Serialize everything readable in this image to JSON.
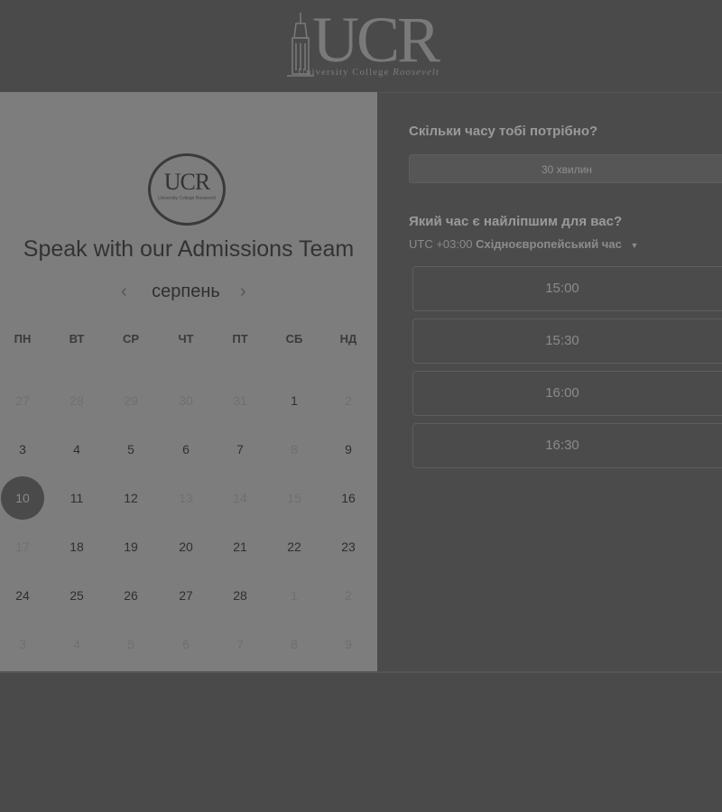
{
  "header": {
    "logo_text": "UCR",
    "logo_sub_main": "University College",
    "logo_sub_italic": "Roosevelt"
  },
  "calendar": {
    "badge_text": "UCR",
    "badge_sub": "University College Roosevelt",
    "title": "Speak with our Admissions Team",
    "month": "серпень",
    "prev_icon": "‹",
    "next_icon": "›",
    "weekdays": [
      "ПН",
      "ВТ",
      "СР",
      "ЧТ",
      "ПТ",
      "СБ",
      "НД"
    ],
    "weeks": [
      [
        {
          "d": "27",
          "muted": true
        },
        {
          "d": "28",
          "muted": true
        },
        {
          "d": "29",
          "muted": true
        },
        {
          "d": "30",
          "muted": true
        },
        {
          "d": "31",
          "muted": true
        },
        {
          "d": "1"
        },
        {
          "d": "2",
          "muted": true
        }
      ],
      [
        {
          "d": "3"
        },
        {
          "d": "4"
        },
        {
          "d": "5"
        },
        {
          "d": "6"
        },
        {
          "d": "7"
        },
        {
          "d": "8",
          "muted": true
        },
        {
          "d": "9"
        }
      ],
      [
        {
          "d": "10",
          "selected": true
        },
        {
          "d": "11"
        },
        {
          "d": "12"
        },
        {
          "d": "13",
          "muted": true
        },
        {
          "d": "14",
          "muted": true
        },
        {
          "d": "15",
          "muted": true
        },
        {
          "d": "16"
        }
      ],
      [
        {
          "d": "17",
          "muted": true
        },
        {
          "d": "18"
        },
        {
          "d": "19"
        },
        {
          "d": "20"
        },
        {
          "d": "21"
        },
        {
          "d": "22"
        },
        {
          "d": "23"
        }
      ],
      [
        {
          "d": "24"
        },
        {
          "d": "25"
        },
        {
          "d": "26"
        },
        {
          "d": "27"
        },
        {
          "d": "28"
        },
        {
          "d": "1",
          "muted": true
        },
        {
          "d": "2",
          "muted": true
        }
      ],
      [
        {
          "d": "3",
          "muted": true
        },
        {
          "d": "4",
          "muted": true
        },
        {
          "d": "5",
          "muted": true
        },
        {
          "d": "6",
          "muted": true
        },
        {
          "d": "7",
          "muted": true
        },
        {
          "d": "8",
          "muted": true
        },
        {
          "d": "9",
          "muted": true
        }
      ]
    ]
  },
  "booking": {
    "duration_question": "Скільки часу тобі потрібно?",
    "duration_value": "30 хвилин",
    "time_question": "Який час є найліпшим для вас?",
    "timezone_offset": "UTC +03:00",
    "timezone_name": "Східноєвропейський час",
    "timezone_caret": "▼",
    "slots": [
      "15:00",
      "15:30",
      "16:00",
      "16:30"
    ]
  },
  "colors": {
    "overlay_dark": "#4a4a4a",
    "calendar_bg": "#7d7d7d",
    "selected_day_bg": "#4a4a4a"
  }
}
